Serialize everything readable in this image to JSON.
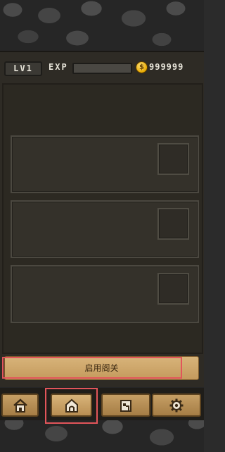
{
  "top_bar": {
    "level": "LV1",
    "exp_label": "EXP",
    "exp_progress": 0,
    "coin_symbol": "$",
    "coins": "999999"
  },
  "slots": [
    {
      "name": "slot-1"
    },
    {
      "name": "slot-2"
    },
    {
      "name": "slot-3"
    }
  ],
  "start_button": {
    "label": "启用阁关"
  },
  "nav": {
    "items": [
      {
        "icon": "house-icon"
      },
      {
        "icon": "home-icon",
        "active": true
      },
      {
        "icon": "shop-icon"
      },
      {
        "icon": "gear-icon"
      }
    ]
  },
  "colors": {
    "accent": "#e2555a",
    "button": "#d8b47a",
    "panel": "#2e2b25",
    "coin": "#e6a800"
  }
}
